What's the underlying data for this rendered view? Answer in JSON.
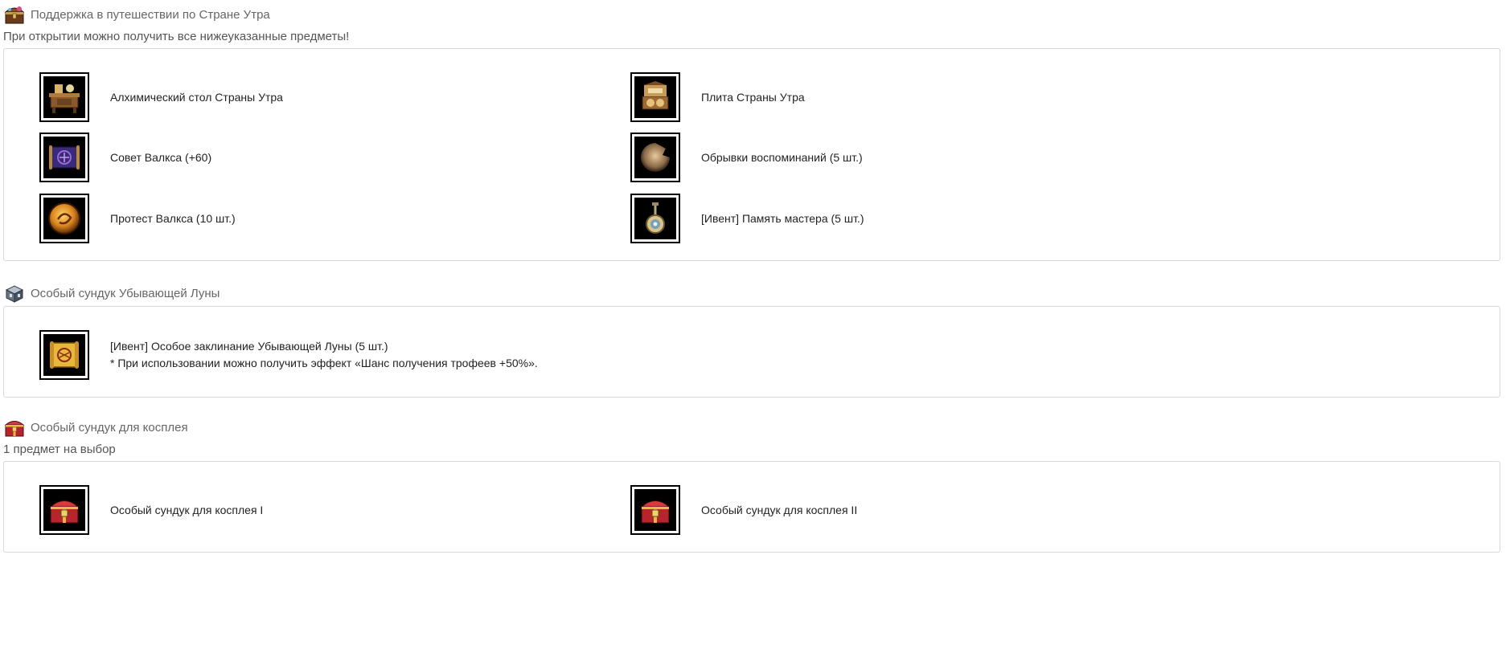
{
  "sections": [
    {
      "title": "Поддержка в путешествии по Стране Утра",
      "subtitle": "При открытии можно получить все нижеуказанные предметы!",
      "items": [
        {
          "label": "Алхимический стол Страны Утра",
          "icon": "alchemy-table-icon"
        },
        {
          "label": "Плита Страны Утра",
          "icon": "stove-icon"
        },
        {
          "label": "Совет Валкса (+60)",
          "icon": "scroll-icon"
        },
        {
          "label": "Обрывки воспоминаний (5 шт.)",
          "icon": "memory-fragment-icon"
        },
        {
          "label": "Протест Валкса (10 шт.)",
          "icon": "orb-icon"
        },
        {
          "label": "[Ивент] Память мастера (5 шт.)",
          "icon": "pendant-icon"
        }
      ]
    },
    {
      "title": "Особый сундук Убывающей Луны",
      "items": [
        {
          "label": "[Ивент] Особое заклинание Убывающей Луны (5 шт.)",
          "note": "* При использовании можно получить эффект «Шанс получения трофеев +50%».",
          "icon": "golden-scroll-icon"
        }
      ]
    },
    {
      "title": "Особый сундук для косплея",
      "subtitle": "1 предмет на выбор",
      "items": [
        {
          "label": "Особый сундук для косплея I",
          "icon": "cosplay-chest-icon"
        },
        {
          "label": "Особый сундук для косплея II",
          "icon": "cosplay-chest-icon"
        }
      ]
    }
  ]
}
